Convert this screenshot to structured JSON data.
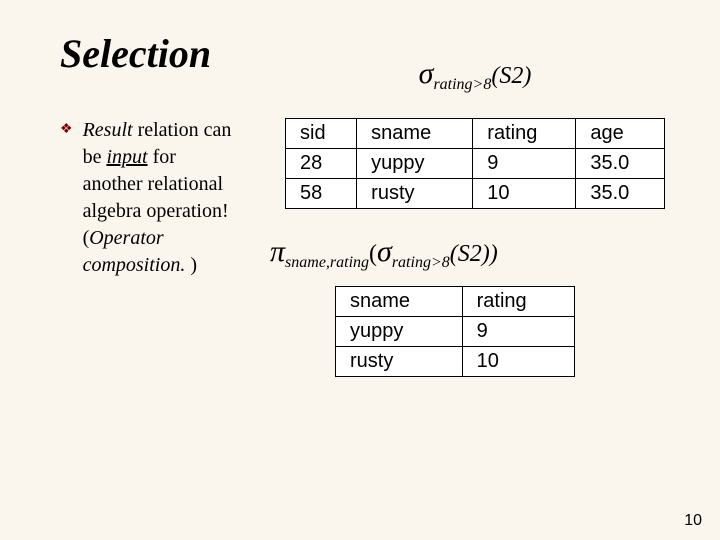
{
  "title": "Selection",
  "bullet": {
    "icon": "❖",
    "t1": "Result",
    "t2": " relation can be ",
    "t3": "input",
    "t4": " for another relational algebra operation! (",
    "t5": "Operator composition.",
    "t6": " )"
  },
  "formula1": {
    "sigma": "σ",
    "sub": "rating>8",
    "arg": "(S2)"
  },
  "table1": {
    "h1": "sid",
    "h2": "sname",
    "h3": "rating",
    "h4": "age",
    "r1c1": "28",
    "r1c2": "yuppy",
    "r1c3": "9",
    "r1c4": "35.0",
    "r2c1": "58",
    "r2c2": "rusty",
    "r2c3": "10",
    "r2c4": "35.0"
  },
  "formula2": {
    "pi": "π",
    "pisub": "sname,rating",
    "sigma": "σ",
    "sigmasub": "rating>8",
    "arg": "(S2))",
    "open": "("
  },
  "table2": {
    "h1": "sname",
    "h2": "rating",
    "r1c1": "yuppy",
    "r1c2": "9",
    "r2c1": "rusty",
    "r2c2": "10"
  },
  "page_num": "10"
}
